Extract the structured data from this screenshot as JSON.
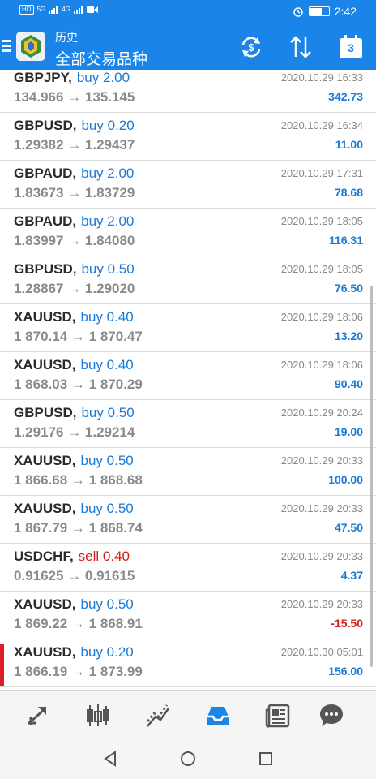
{
  "statusbar": {
    "left_chip": "HD",
    "signal_1": "5G",
    "signal_2": "4G",
    "time": "2:42"
  },
  "header": {
    "title": "历史",
    "subtitle": "全部交易品种",
    "calendar_day": "3"
  },
  "trades": [
    {
      "symbol": "GBPJPY,",
      "side": "buy",
      "lots": "2.00",
      "open": "134.966",
      "close": "135.145",
      "date": "2020.10.29 16:33",
      "profit": "342.73"
    },
    {
      "symbol": "GBPUSD,",
      "side": "buy",
      "lots": "0.20",
      "open": "1.29382",
      "close": "1.29437",
      "date": "2020.10.29 16:34",
      "profit": "11.00"
    },
    {
      "symbol": "GBPAUD,",
      "side": "buy",
      "lots": "2.00",
      "open": "1.83673",
      "close": "1.83729",
      "date": "2020.10.29 17:31",
      "profit": "78.68"
    },
    {
      "symbol": "GBPAUD,",
      "side": "buy",
      "lots": "2.00",
      "open": "1.83997",
      "close": "1.84080",
      "date": "2020.10.29 18:05",
      "profit": "116.31"
    },
    {
      "symbol": "GBPUSD,",
      "side": "buy",
      "lots": "0.50",
      "open": "1.28867",
      "close": "1.29020",
      "date": "2020.10.29 18:05",
      "profit": "76.50"
    },
    {
      "symbol": "XAUUSD,",
      "side": "buy",
      "lots": "0.40",
      "open": "1 870.14",
      "close": "1 870.47",
      "date": "2020.10.29 18:06",
      "profit": "13.20"
    },
    {
      "symbol": "XAUUSD,",
      "side": "buy",
      "lots": "0.40",
      "open": "1 868.03",
      "close": "1 870.29",
      "date": "2020.10.29 18:06",
      "profit": "90.40"
    },
    {
      "symbol": "GBPUSD,",
      "side": "buy",
      "lots": "0.50",
      "open": "1.29176",
      "close": "1.29214",
      "date": "2020.10.29 20:24",
      "profit": "19.00"
    },
    {
      "symbol": "XAUUSD,",
      "side": "buy",
      "lots": "0.50",
      "open": "1 866.68",
      "close": "1 868.68",
      "date": "2020.10.29 20:33",
      "profit": "100.00"
    },
    {
      "symbol": "XAUUSD,",
      "side": "buy",
      "lots": "0.50",
      "open": "1 867.79",
      "close": "1 868.74",
      "date": "2020.10.29 20:33",
      "profit": "47.50"
    },
    {
      "symbol": "USDCHF,",
      "side": "sell",
      "lots": "0.40",
      "open": "0.91625",
      "close": "0.91615",
      "date": "2020.10.29 20:33",
      "profit": "4.37"
    },
    {
      "symbol": "XAUUSD,",
      "side": "buy",
      "lots": "0.50",
      "open": "1 869.22",
      "close": "1 868.91",
      "date": "2020.10.29 20:33",
      "profit": "-15.50"
    },
    {
      "symbol": "XAUUSD,",
      "side": "buy",
      "lots": "0.20",
      "open": "1 866.19",
      "close": "1 873.99",
      "date": "2020.10.30 05:01",
      "profit": "156.00"
    }
  ],
  "arrow": "→",
  "bottom_nav": [
    "quotes-icon",
    "chart-icon",
    "trade-icon",
    "history-icon",
    "news-icon",
    "chat-icon"
  ],
  "colors": {
    "header": "#1a84e8",
    "buy": "#1a7ad4",
    "sell": "#d21e1e",
    "negative_profit": "#d21e1e",
    "active_tab": "#1a84e8"
  }
}
